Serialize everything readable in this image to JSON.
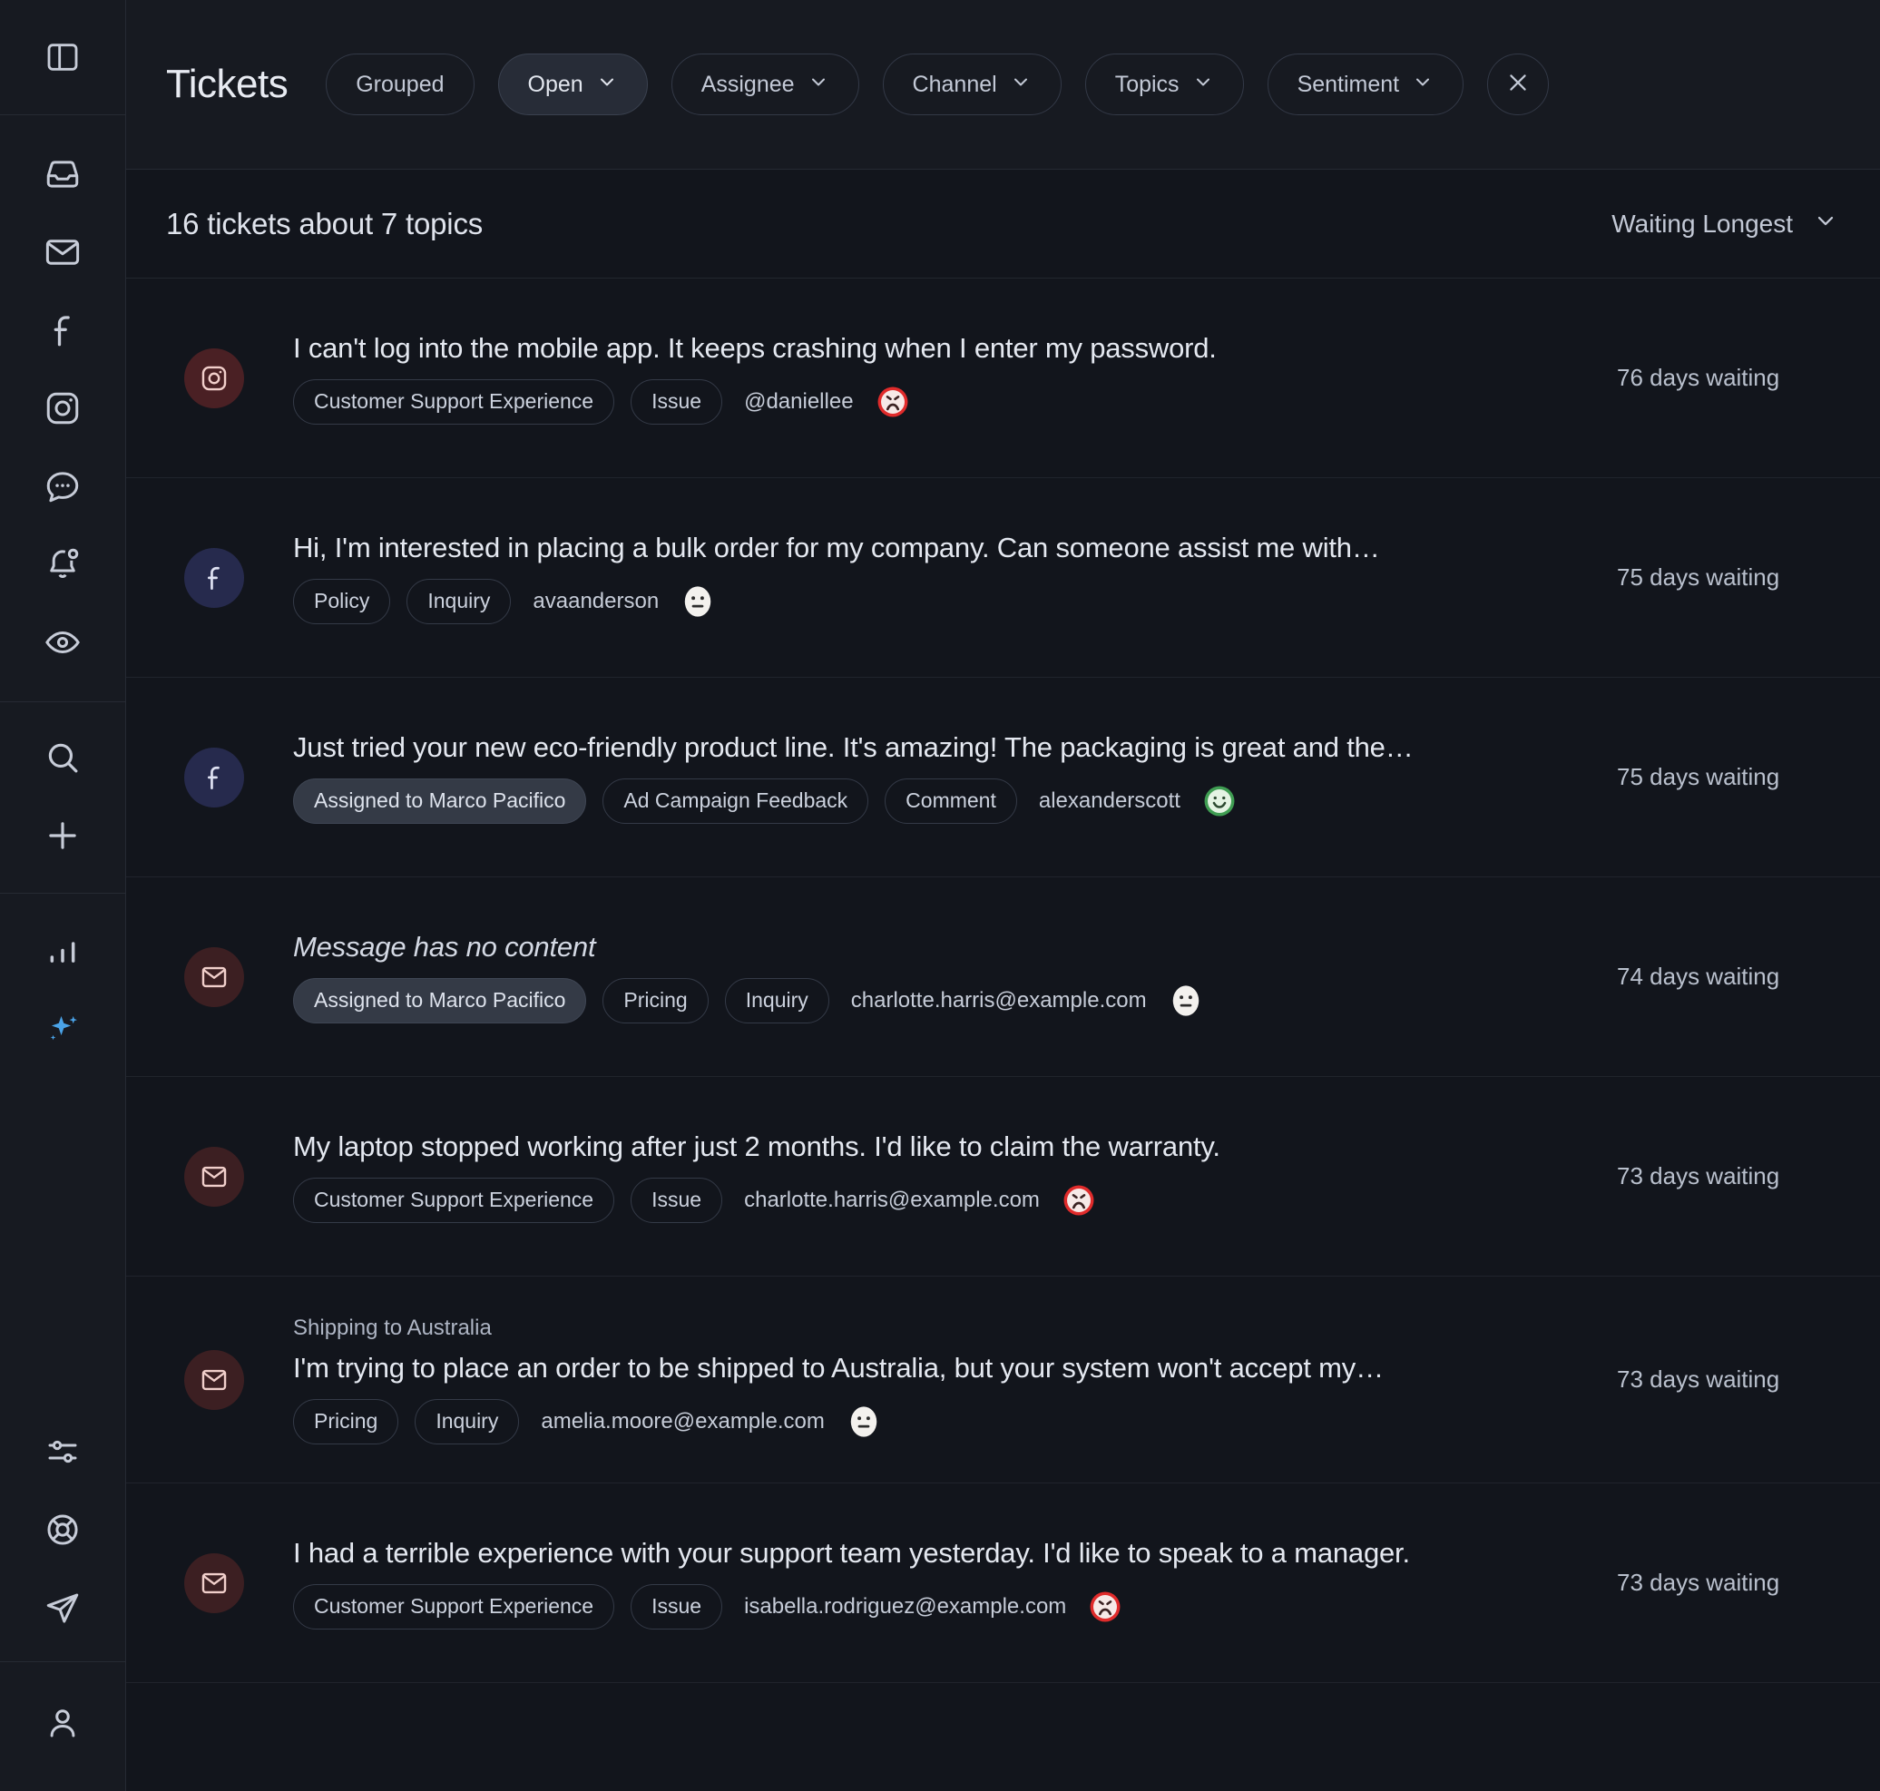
{
  "sidebar": {
    "top": [
      {
        "icon": "panel-toggle-icon",
        "name": "sidebar-toggle"
      }
    ],
    "channels": [
      {
        "icon": "inbox-icon",
        "name": "sidebar-item-inbox"
      },
      {
        "icon": "envelope-icon",
        "name": "sidebar-item-email"
      },
      {
        "icon": "facebook-icon",
        "name": "sidebar-item-facebook"
      },
      {
        "icon": "instagram-icon",
        "name": "sidebar-item-instagram"
      },
      {
        "icon": "chat-bubble-icon",
        "name": "sidebar-item-messages"
      },
      {
        "icon": "bell-dot-icon",
        "name": "sidebar-item-notifications"
      },
      {
        "icon": "eye-icon",
        "name": "sidebar-item-monitoring"
      }
    ],
    "actions": [
      {
        "icon": "search-icon",
        "name": "sidebar-item-search"
      },
      {
        "icon": "plus-icon",
        "name": "sidebar-item-create"
      }
    ],
    "insights": [
      {
        "icon": "bar-chart-icon",
        "name": "sidebar-item-analytics",
        "active": false
      },
      {
        "icon": "ai-sparkle-icon",
        "name": "sidebar-item-ai",
        "active": true
      }
    ],
    "utility": [
      {
        "icon": "sliders-icon",
        "name": "sidebar-item-settings"
      },
      {
        "icon": "life-ring-icon",
        "name": "sidebar-item-help"
      },
      {
        "icon": "send-icon",
        "name": "sidebar-item-send"
      }
    ],
    "account": [
      {
        "icon": "user-icon",
        "name": "sidebar-item-account"
      }
    ]
  },
  "header": {
    "title": "Tickets",
    "filters": [
      {
        "label": "Grouped",
        "caret": false,
        "selected": false
      },
      {
        "label": "Open",
        "caret": true,
        "selected": true
      },
      {
        "label": "Assignee",
        "caret": true,
        "selected": false
      },
      {
        "label": "Channel",
        "caret": true,
        "selected": false
      },
      {
        "label": "Topics",
        "caret": true,
        "selected": false
      },
      {
        "label": "Sentiment",
        "caret": true,
        "selected": false
      }
    ],
    "clear_filters_icon": "close-icon"
  },
  "subheader": {
    "count_text": "16 tickets about 7 topics",
    "sort_label": "Waiting Longest",
    "sort_caret_icon": "chevron-down-icon"
  },
  "colors": {
    "accent": "#4aa3e8",
    "negative": "#e03b3b",
    "positive": "#3f9d52",
    "neutral": "#d9dde6",
    "background": "#12151c",
    "panel": "#171a21"
  },
  "tickets": [
    {
      "channel": "instagram",
      "subject": "",
      "preview": "I can't log into the mobile app. It keeps crashing when I enter my password.",
      "empty": false,
      "tags": [
        "Customer Support Experience",
        "Issue"
      ],
      "assigned": "",
      "who": "@daniellee",
      "sentiment": "negative",
      "waiting": "76 days waiting"
    },
    {
      "channel": "facebook",
      "subject": "",
      "preview": "Hi, I'm interested in placing a bulk order for my company. Can someone assist me with…",
      "empty": false,
      "tags": [
        "Policy",
        "Inquiry"
      ],
      "assigned": "",
      "who": "avaanderson",
      "sentiment": "neutral",
      "waiting": "75 days waiting"
    },
    {
      "channel": "facebook",
      "subject": "",
      "preview": "Just tried your new eco-friendly product line. It's amazing! The packaging is great and the…",
      "empty": false,
      "tags": [
        "Ad Campaign Feedback",
        "Comment"
      ],
      "assigned": "Assigned to Marco Pacifico",
      "who": "alexanderscott",
      "sentiment": "positive",
      "waiting": "75 days waiting"
    },
    {
      "channel": "email",
      "subject": "",
      "preview": "Message has no content",
      "empty": true,
      "tags": [
        "Pricing",
        "Inquiry"
      ],
      "assigned": "Assigned to Marco Pacifico",
      "who": "charlotte.harris@example.com",
      "sentiment": "neutral",
      "waiting": "74 days waiting"
    },
    {
      "channel": "email",
      "subject": "",
      "preview": "My laptop stopped working after just 2 months. I'd like to claim the warranty.",
      "empty": false,
      "tags": [
        "Customer Support Experience",
        "Issue"
      ],
      "assigned": "",
      "who": "charlotte.harris@example.com",
      "sentiment": "negative",
      "waiting": "73 days waiting"
    },
    {
      "channel": "email",
      "subject": "Shipping to Australia",
      "preview": "I'm trying to place an order to be shipped to Australia, but your system won't accept my…",
      "empty": false,
      "tags": [
        "Pricing",
        "Inquiry"
      ],
      "assigned": "",
      "who": "amelia.moore@example.com",
      "sentiment": "neutral",
      "waiting": "73 days waiting"
    },
    {
      "channel": "email",
      "subject": "",
      "preview": "I had a terrible experience with your support team yesterday. I'd like to speak to a manager.",
      "empty": false,
      "tags": [
        "Customer Support Experience",
        "Issue"
      ],
      "assigned": "",
      "who": "isabella.rodriguez@example.com",
      "sentiment": "negative",
      "waiting": "73 days waiting"
    }
  ]
}
